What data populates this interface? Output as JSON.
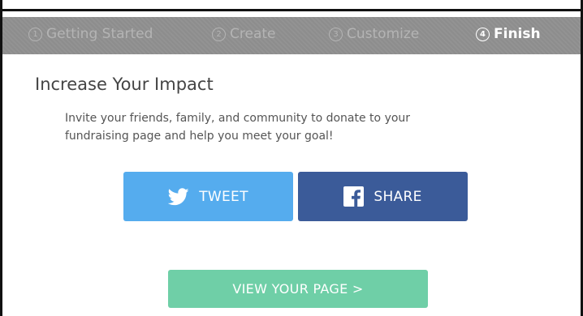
{
  "steps": [
    {
      "num": "1",
      "label": "Getting Started",
      "active": false
    },
    {
      "num": "2",
      "label": "Create",
      "active": false
    },
    {
      "num": "3",
      "label": "Customize",
      "active": false
    },
    {
      "num": "4",
      "label": "Finish",
      "active": true
    }
  ],
  "main": {
    "title": "Increase Your Impact",
    "description": "Invite your friends, family, and community to donate to your fundraising page and help you meet your goal!"
  },
  "buttons": {
    "tweet": {
      "label": "TWEET",
      "icon": "twitter-bird-icon",
      "color": "#55acee"
    },
    "share": {
      "label": "SHARE",
      "icon": "facebook-icon",
      "color": "#3b5b99"
    },
    "view_page": {
      "label": "VIEW YOUR PAGE >",
      "color": "#6fcfa7"
    }
  },
  "colors": {
    "step_bar": "#8d8d8d",
    "step_inactive": "#b4b4b4",
    "step_active": "#ffffff"
  }
}
